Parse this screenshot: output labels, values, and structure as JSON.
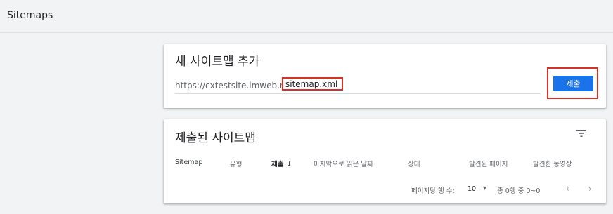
{
  "header": {
    "title": "Sitemaps"
  },
  "add_card": {
    "title": "새 사이트맵 추가",
    "url_prefix": "https://cxtestsite.imweb.me/",
    "input_value": "sitemap.xml",
    "submit_label": "제출"
  },
  "list_card": {
    "title": "제출된 사이트맵",
    "columns": {
      "sitemap": "Sitemap",
      "type": "유형",
      "submitted": "제출",
      "submitted_arrow": "↓",
      "last_read": "마지막으로 읽은 날짜",
      "status": "상태",
      "discovered_pages": "발견된 페이지",
      "discovered_videos": "발견한 동영상"
    },
    "pagination": {
      "rows_label": "페이지당 행 수:",
      "rows_value": "10",
      "range_text": "총 0행 중 0~0",
      "caret": "▾",
      "prev": "‹",
      "next": "›"
    }
  },
  "colors": {
    "accent": "#1a73e8",
    "highlight_outline": "#d93025",
    "background": "#f1f3f4"
  }
}
